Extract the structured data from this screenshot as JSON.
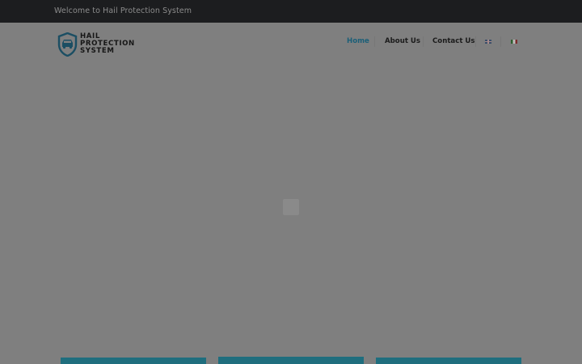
{
  "topbar": {
    "welcome": "Welcome to Hail Protection System"
  },
  "logo": {
    "lines": [
      "HAIL",
      "PROTECTION",
      "SYSTEM"
    ]
  },
  "nav": {
    "items": [
      {
        "label": "Home",
        "active": true
      },
      {
        "label": "About Us",
        "active": false
      },
      {
        "label": "Contact Us",
        "active": false
      }
    ],
    "languages": [
      "en-flag-icon",
      "it-flag-icon"
    ]
  },
  "colors": {
    "topbar": "#1c1d1f",
    "overlay": "#7f7f7f",
    "active_nav": "#1b5f78",
    "card": "#1f6e7e"
  }
}
